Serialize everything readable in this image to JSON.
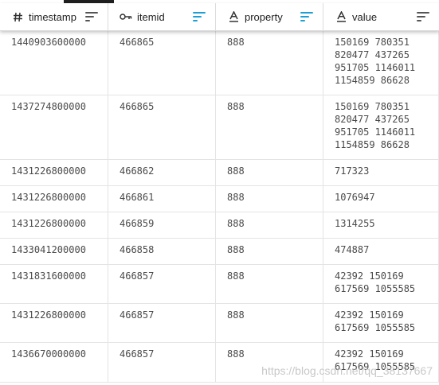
{
  "header": {
    "columns": [
      {
        "label": "timestamp",
        "type_icon": "hash-icon",
        "sort_color": "#555555"
      },
      {
        "label": "itemid",
        "type_icon": "key-icon",
        "sort_color": "#1a9fd6"
      },
      {
        "label": "property",
        "type_icon": "text-a-icon",
        "sort_color": "#1a9fd6"
      },
      {
        "label": "value",
        "type_icon": "text-a-icon",
        "sort_color": "#555555"
      }
    ]
  },
  "rows": [
    {
      "timestamp": "1440903600000",
      "itemid": "466865",
      "property": "888",
      "value": "150169 780351\n820477 437265\n951705 1146011\n1154859 86628"
    },
    {
      "timestamp": "1437274800000",
      "itemid": "466865",
      "property": "888",
      "value": "150169 780351\n820477 437265\n951705 1146011\n1154859 86628"
    },
    {
      "timestamp": "1431226800000",
      "itemid": "466862",
      "property": "888",
      "value": "717323"
    },
    {
      "timestamp": "1431226800000",
      "itemid": "466861",
      "property": "888",
      "value": "1076947"
    },
    {
      "timestamp": "1431226800000",
      "itemid": "466859",
      "property": "888",
      "value": "1314255"
    },
    {
      "timestamp": "1433041200000",
      "itemid": "466858",
      "property": "888",
      "value": "474887"
    },
    {
      "timestamp": "1431831600000",
      "itemid": "466857",
      "property": "888",
      "value": "42392 150169\n617569 1055585"
    },
    {
      "timestamp": "1431226800000",
      "itemid": "466857",
      "property": "888",
      "value": "42392 150169\n617569 1055585"
    },
    {
      "timestamp": "1436670000000",
      "itemid": "466857",
      "property": "888",
      "value": "42392 150169\n617569 1055585"
    }
  ],
  "watermark": "https://blog.csdn.net/qq_38137667"
}
